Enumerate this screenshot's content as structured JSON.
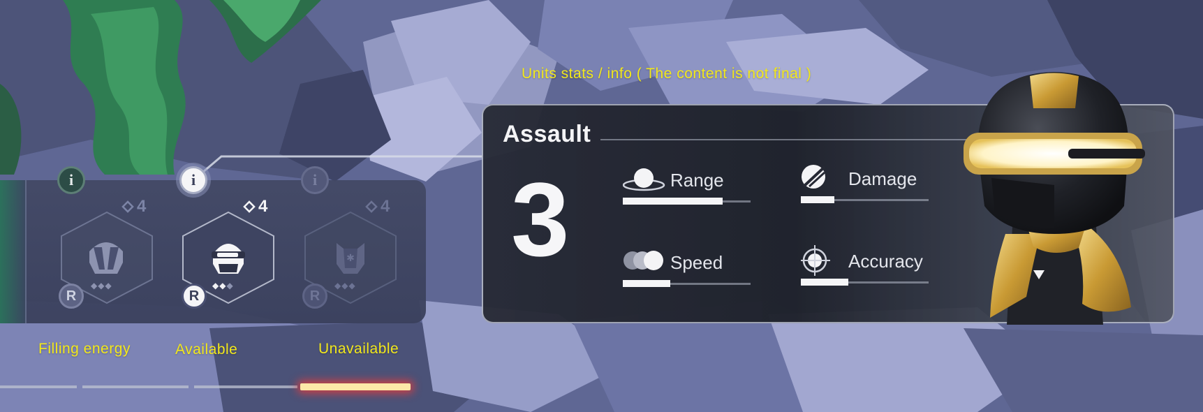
{
  "captions": {
    "header": "Units stats / info  ( The content is not final )",
    "filling": "Filling energy",
    "available": "Available",
    "unavailable": "Unavailable"
  },
  "slots": [
    {
      "state": "filling",
      "cost": "4",
      "rarity": "R",
      "info_icon": "info-icon",
      "unit_icon": "tank-helmet-icon"
    },
    {
      "state": "available",
      "cost": "4",
      "rarity": "R",
      "info_icon": "info-icon",
      "unit_icon": "assault-helmet-icon"
    },
    {
      "state": "unavailable",
      "cost": "4",
      "rarity": "R",
      "info_icon": "info-icon",
      "unit_icon": "shield-unit-icon"
    }
  ],
  "unit": {
    "name": "Assault",
    "level": "3",
    "stats": [
      {
        "label": "Range",
        "icon": "range-icon",
        "value": 0.78
      },
      {
        "label": "Damage",
        "icon": "damage-icon",
        "value": 0.26
      },
      {
        "label": "Speed",
        "icon": "speed-icon",
        "value": 0.37
      },
      {
        "label": "Accuracy",
        "icon": "accuracy-icon",
        "value": 0.37
      }
    ]
  },
  "energy_strip": {
    "active_segment": 4,
    "segments": 4
  },
  "colors": {
    "caption": "#f2e81c",
    "panel_bg": "#262934",
    "accent_gold": "#d9b34a",
    "active_strip": "#fde9a8",
    "active_glow": "#e63c3c"
  }
}
